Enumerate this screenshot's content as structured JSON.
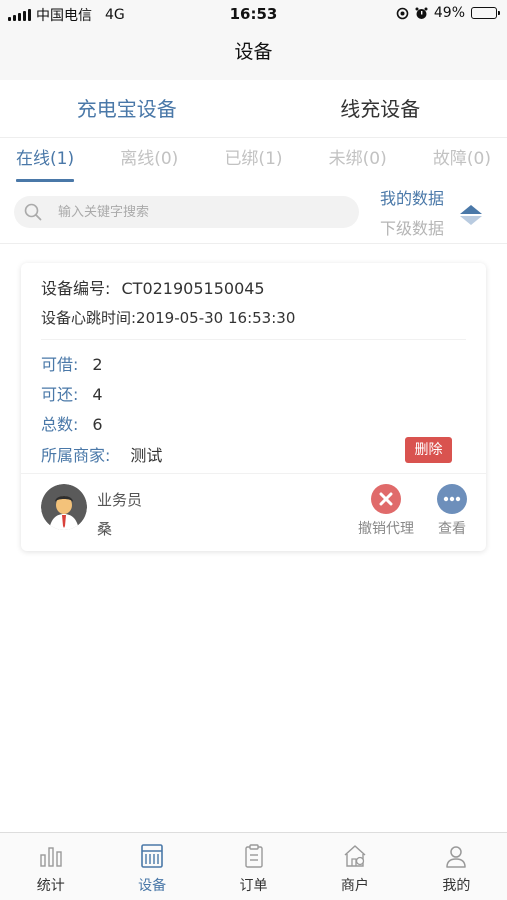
{
  "status_bar": {
    "carrier": "中国电信",
    "network": "4G",
    "time": "16:53",
    "battery": "49%",
    "battery_level": 0.49
  },
  "nav": {
    "title": "设备"
  },
  "device_types": [
    {
      "label": "充电宝设备",
      "active": true
    },
    {
      "label": "线充设备",
      "active": false
    }
  ],
  "status_tabs": [
    {
      "label": "在线(1)",
      "active": true
    },
    {
      "label": "离线(0)",
      "active": false
    },
    {
      "label": "已绑(1)",
      "active": false
    },
    {
      "label": "未绑(0)",
      "active": false
    },
    {
      "label": "故障(0)",
      "active": false
    }
  ],
  "search": {
    "placeholder": "输入关键字搜索",
    "value": ""
  },
  "data_scope": {
    "mine": "我的数据",
    "sub": "下级数据"
  },
  "device": {
    "sn_label": "设备编号:",
    "sn_value": "CT021905150045",
    "heartbeat": "设备心跳时间:2019-05-30 16:53:30",
    "borrowable_label": "可借:",
    "borrowable": "2",
    "returnable_label": "可还:",
    "returnable": "4",
    "total_label": "总数:",
    "total": "6",
    "merchant_label": "所属商家:",
    "merchant": "测试",
    "delete_label": "删除",
    "role": "业务员",
    "agent_name": "桑",
    "revoke_label": "撤销代理",
    "view_label": "查看"
  },
  "tab_bar": [
    {
      "label": "统计",
      "icon": "bar-chart-icon",
      "active": false
    },
    {
      "label": "设备",
      "icon": "device-icon",
      "active": true
    },
    {
      "label": "订单",
      "icon": "clipboard-icon",
      "active": false
    },
    {
      "label": "商户",
      "icon": "shop-icon",
      "active": false
    },
    {
      "label": "我的",
      "icon": "user-icon",
      "active": false
    }
  ],
  "colors": {
    "accent": "#4a78a8",
    "danger": "#d9534f",
    "inactive": "#c2c2c2"
  }
}
